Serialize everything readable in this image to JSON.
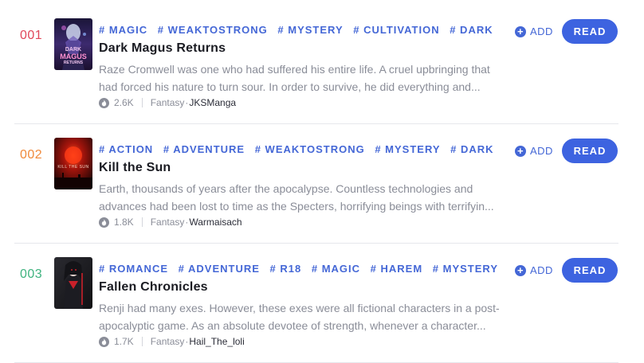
{
  "add_label": "ADD",
  "read_label": "READ",
  "accent_color": "#3d63e0",
  "books": [
    {
      "rank": "001",
      "rank_color": "#e0475a",
      "tags": [
        "# MAGIC",
        "# WEAKTOSTRONG",
        "# MYSTERY",
        "# CULTIVATION",
        "# DARK"
      ],
      "title": "Dark Magus Returns",
      "description": "Raze Cromwell was one who had suffered his entire life. A cruel upbringing that had forced his nature to turn sour. In order to survive, he did everything and...",
      "views": "2.6K",
      "genre": "Fantasy",
      "author": "JKSManga",
      "cover_text": [
        "DARK",
        "MAGUS",
        "RETURNS"
      ]
    },
    {
      "rank": "002",
      "rank_color": "#f08a3c",
      "tags": [
        "# ACTION",
        "# ADVENTURE",
        "# WEAKTOSTRONG",
        "# MYSTERY",
        "# DARK"
      ],
      "title": "Kill the Sun",
      "description": "Earth, thousands of years after the apocalypse. Countless technologies and advances had been lost to time as the Specters, horrifying beings with terrifyin...",
      "views": "1.8K",
      "genre": "Fantasy",
      "author": "Warmaisach",
      "cover_text": [
        "KILL THE SUN"
      ]
    },
    {
      "rank": "003",
      "rank_color": "#3fb37f",
      "tags": [
        "# ROMANCE",
        "# ADVENTURE",
        "# R18",
        "# MAGIC",
        "# HAREM",
        "# MYSTERY"
      ],
      "title": "Fallen Chronicles",
      "description": "Renji had many exes. However, these exes were all fictional characters in a post-apocalyptic game. As an absolute devotee of strength, whenever a character...",
      "views": "1.7K",
      "genre": "Fantasy",
      "author": "Hail_The_loli",
      "cover_text": []
    }
  ]
}
